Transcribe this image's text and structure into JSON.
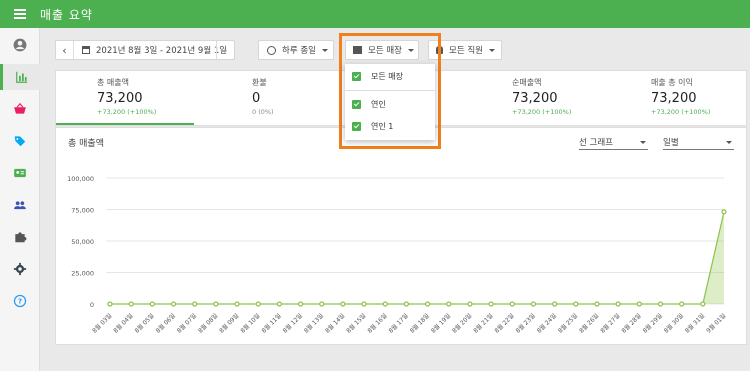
{
  "header": {
    "title": "매출 요약"
  },
  "sidebar": {
    "items": [
      {
        "icon": "account-icon"
      },
      {
        "icon": "bar-chart-icon"
      },
      {
        "icon": "basket-icon"
      },
      {
        "icon": "tag-icon"
      },
      {
        "icon": "id-card-icon"
      },
      {
        "icon": "people-icon"
      },
      {
        "icon": "puzzle-icon"
      },
      {
        "icon": "gear-icon"
      },
      {
        "icon": "help-icon"
      }
    ]
  },
  "toolbar": {
    "prev": "‹",
    "date_range": "2021년 8월 3일 - 2021년 9월 1일",
    "next": "›",
    "time_filter": "하루 종일",
    "store_filter": "모든 매장",
    "staff_filter": "모든 직원"
  },
  "store_dropdown": {
    "items": [
      {
        "label": "모든 매장",
        "checked": true
      },
      {
        "label": "연인",
        "checked": true
      },
      {
        "label": "연인 1",
        "checked": true
      }
    ]
  },
  "summary": {
    "stats": [
      {
        "label": "총 매출액",
        "value": "73,200",
        "change": "+73,200 (+100%)"
      },
      {
        "label": "환불",
        "value": "0",
        "change": "0 (0%)"
      },
      {
        "label": "순매출액",
        "value": "73,200",
        "change": "+73,200 (+100%)"
      },
      {
        "label": "매출 총 이익",
        "value": "73,200",
        "change": "+73,200 (+100%)"
      }
    ]
  },
  "chart_panel": {
    "title": "총 매출액",
    "chart_type_select": "선 그래프",
    "period_select": "일별"
  },
  "chart_data": {
    "type": "area",
    "categories": [
      "8월 03일",
      "8월 04일",
      "8월 05일",
      "8월 06일",
      "8월 07일",
      "8월 08일",
      "8월 09일",
      "8월 10일",
      "8월 11일",
      "8월 12일",
      "8월 13일",
      "8월 14일",
      "8월 15일",
      "8월 16일",
      "8월 17일",
      "8월 18일",
      "8월 19일",
      "8월 20일",
      "8월 21일",
      "8월 22일",
      "8월 23일",
      "8월 24일",
      "8월 25일",
      "8월 26일",
      "8월 27일",
      "8월 28일",
      "8월 29일",
      "8월 30일",
      "8월 31일",
      "9월 01일"
    ],
    "series": [
      {
        "values": [
          0,
          0,
          0,
          0,
          0,
          0,
          0,
          0,
          0,
          0,
          0,
          0,
          0,
          0,
          0,
          0,
          0,
          0,
          0,
          0,
          0,
          0,
          0,
          0,
          0,
          0,
          0,
          0,
          0,
          73200
        ]
      }
    ],
    "yticks": [
      "0",
      "25,000",
      "50,000",
      "75,000",
      "100,000"
    ],
    "ylim": [
      0,
      100000
    ],
    "grid": true,
    "color": "#8bc34a"
  }
}
